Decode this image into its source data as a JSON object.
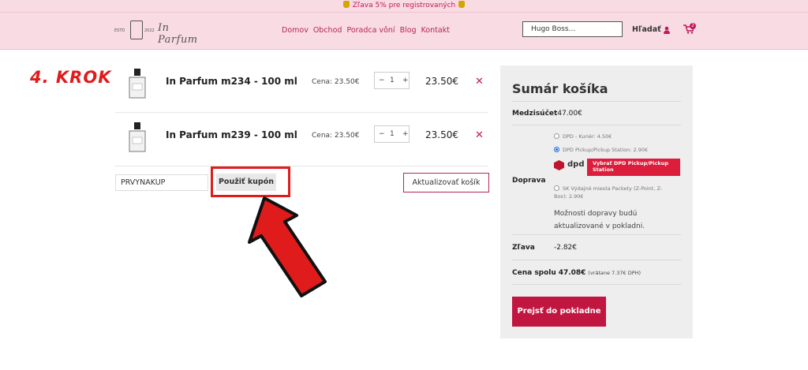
{
  "promo": {
    "text": "Zľava 5% pre registrovaných"
  },
  "header": {
    "logo_estd": "ESTD",
    "logo_year": "2022",
    "logo_script": "In Parfum",
    "nav": [
      "Domov",
      "Obchod",
      "Poradca vôní",
      "Blog",
      "Kontakt"
    ],
    "search_value": "Hugo Boss...",
    "search_label": "Hľadať",
    "cart_count": "2"
  },
  "annotation": {
    "step": "4. KROK"
  },
  "cart": {
    "items": [
      {
        "name": "In Parfum m234 - 100 ml",
        "price_label": "Cena: 23.50€",
        "qty": "1",
        "total": "23.50€"
      },
      {
        "name": "In Parfum m239 - 100 ml",
        "price_label": "Cena: 23.50€",
        "qty": "1",
        "total": "23.50€"
      }
    ],
    "qty_minus": "−",
    "qty_plus": "+",
    "remove": "✕",
    "coupon_value": "PRVYNAKUP",
    "coupon_button": "Použiť kupón",
    "update_button": "Aktualizovať košík"
  },
  "summary": {
    "title": "Sumár košíka",
    "subtotal_label": "Medzisúčet",
    "subtotal_value": "47.00€",
    "shipping_label": "Doprava",
    "shipping_options": [
      "DPD - Kuriér: 4.50€",
      "DPD Pickup/Pickup Station: 2.90€",
      "SK Výdajné miesta Packety (Z-Point, Z-Box): 2.90€"
    ],
    "dpd_logo": "dpd",
    "dpd_button": "Vybrať DPD Pickup/Pickup Station",
    "shipping_note": "Možnosti dopravy budú aktualizované v pokladni.",
    "discount_label": "Zľava",
    "discount_value": "-2.82€",
    "total_label": "Cena spolu",
    "total_value": "47.08€",
    "total_note": "(vrátane 7.37€ DPH)",
    "checkout_button": "Prejsť do pokladne"
  }
}
